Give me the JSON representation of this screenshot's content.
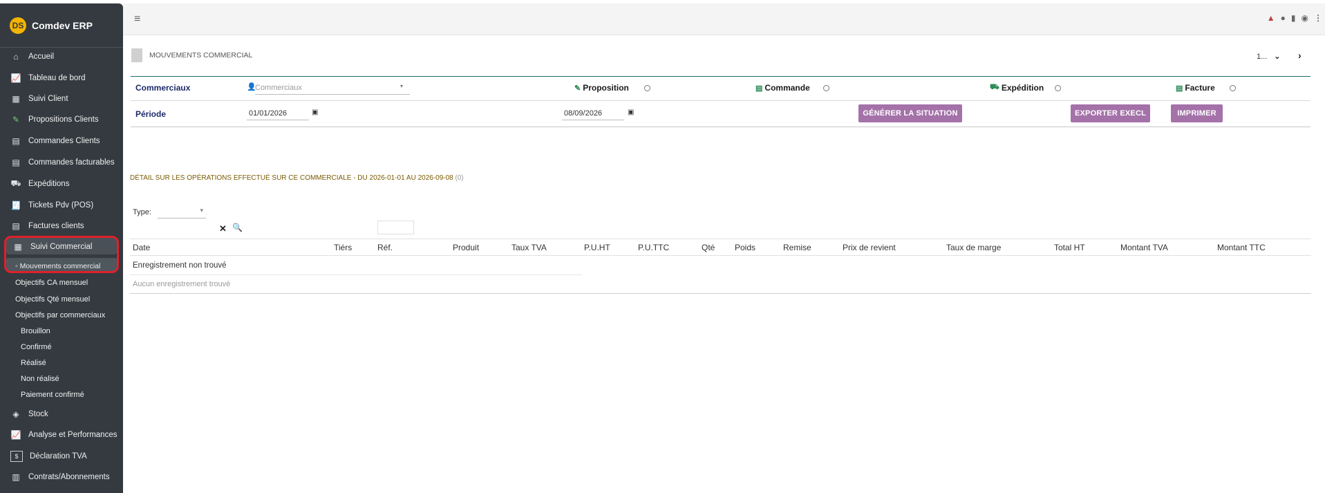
{
  "app": {
    "title": "Comdev ERP",
    "logo_text": "DS"
  },
  "sidebar": {
    "items": [
      {
        "label": "Accueil",
        "icon": "home-icon"
      },
      {
        "label": "Tableau de bord",
        "icon": "chart-line-icon"
      },
      {
        "label": "Suivi Client",
        "icon": "building-icon"
      },
      {
        "label": "Propositions Clients",
        "icon": "file-signature-icon"
      },
      {
        "label": "Commandes Clients",
        "icon": "file-icon"
      },
      {
        "label": "Commandes facturables",
        "icon": "file-icon"
      },
      {
        "label": "Expéditions",
        "icon": "dolly-icon"
      },
      {
        "label": "Tickets Pdv (POS)",
        "icon": "receipt-icon"
      },
      {
        "label": "Factures clients",
        "icon": "file-invoice-icon"
      },
      {
        "label": "Suivi Commercial",
        "icon": "building-icon"
      }
    ],
    "sub_active": "Mouvements commercial",
    "sub_items": [
      "Objectifs CA mensuel",
      "Objectifs Qté mensuel",
      "Objectifs par commerciaux"
    ],
    "sub_sub_items": [
      "Brouillon",
      "Confirmé",
      "Réalisé",
      "Non réalisé",
      "Paiement confirmé"
    ],
    "bottom_items": [
      {
        "label": "Stock",
        "icon": "cube-icon"
      },
      {
        "label": "Analyse et Performances",
        "icon": "chart-line-icon"
      },
      {
        "label": "Déclaration TVA",
        "icon": "money-icon"
      },
      {
        "label": "Contrats/Abonnements",
        "icon": "briefcase-icon"
      }
    ]
  },
  "header": {
    "title": "MOUVEMENTS COMMERCIAL",
    "pager_value": "1..."
  },
  "filters": {
    "commerciaux_label": "Commerciaux",
    "commerciaux_placeholder": "Commerciaux",
    "periode_label": "Période",
    "date_from": "01/01/2026",
    "date_to": "08/09/2026",
    "options": [
      "Proposition",
      "Commande",
      "Expédition",
      "Facture"
    ],
    "buttons": {
      "generate": "GÉNÉRER LA SITUATION",
      "export": "EXPORTER EXECL",
      "print": "IMPRIMER"
    }
  },
  "detail": {
    "title": "DÉTAIL SUR LES OPÉRATIONS EFFECTUÉ SUR CE COMMERCIALE - DU 2026-01-01 AU 2026-09-08",
    "count": "(0)"
  },
  "table": {
    "type_label": "Type:",
    "columns": [
      "Date",
      "Tiérs",
      "Réf.",
      "Produit",
      "Taux TVA",
      "P.U.HT",
      "P.U.TTC",
      "Qté",
      "Poids",
      "Remise",
      "Prix de revient",
      "Taux de marge",
      "Total HT",
      "Montant TVA",
      "Montant TTC"
    ],
    "not_found": "Enregistrement non trouvé",
    "empty": "Aucun enregistrement trouvé"
  }
}
